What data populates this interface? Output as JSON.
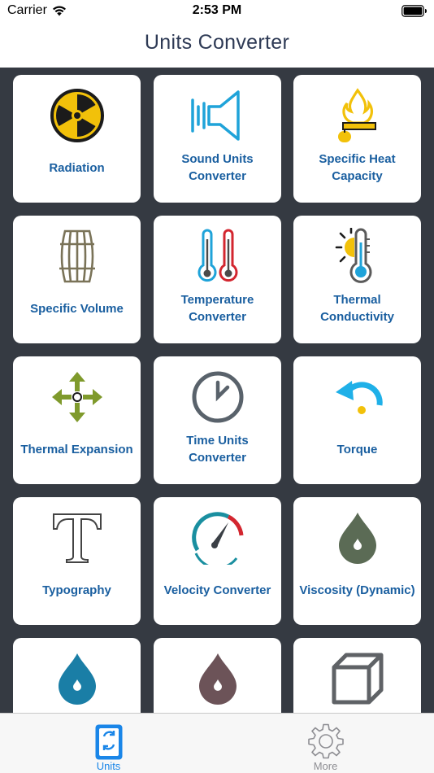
{
  "status_bar": {
    "carrier": "Carrier",
    "time": "2:53 PM"
  },
  "nav": {
    "title": "Units Converter"
  },
  "tiles": [
    {
      "label": "Radiation",
      "icon": "radiation-icon"
    },
    {
      "label": "Sound Units Converter",
      "icon": "speaker-icon"
    },
    {
      "label": "Specific Heat Capacity",
      "icon": "heat-flame-icon"
    },
    {
      "label": "Specific Volume",
      "icon": "barrel-icon"
    },
    {
      "label": "Temperature Converter",
      "icon": "thermometers-icon"
    },
    {
      "label": "Thermal Conductivity",
      "icon": "sun-thermometer-icon"
    },
    {
      "label": "Thermal Expansion",
      "icon": "expand-arrows-icon"
    },
    {
      "label": "Time Units Converter",
      "icon": "clock-icon"
    },
    {
      "label": "Torque",
      "icon": "rotate-arrow-icon"
    },
    {
      "label": "Typography",
      "icon": "letter-t-icon"
    },
    {
      "label": "Velocity Converter",
      "icon": "speedometer-icon"
    },
    {
      "label": "Viscosity (Dynamic)",
      "icon": "green-drop-icon"
    },
    {
      "label": "",
      "icon": "blue-drop-icon"
    },
    {
      "label": "",
      "icon": "purple-drop-icon"
    },
    {
      "label": "",
      "icon": "cube-icon"
    }
  ],
  "tab_bar": {
    "tabs": [
      {
        "label": "Units",
        "icon": "calculator-icon",
        "selected": true
      },
      {
        "label": "More",
        "icon": "gear-icon",
        "selected": false
      }
    ]
  },
  "colors": {
    "accent": "#1a86e8",
    "tile_text": "#1a5fa0",
    "grid_bg": "#353a42",
    "title": "#2e3a55"
  }
}
